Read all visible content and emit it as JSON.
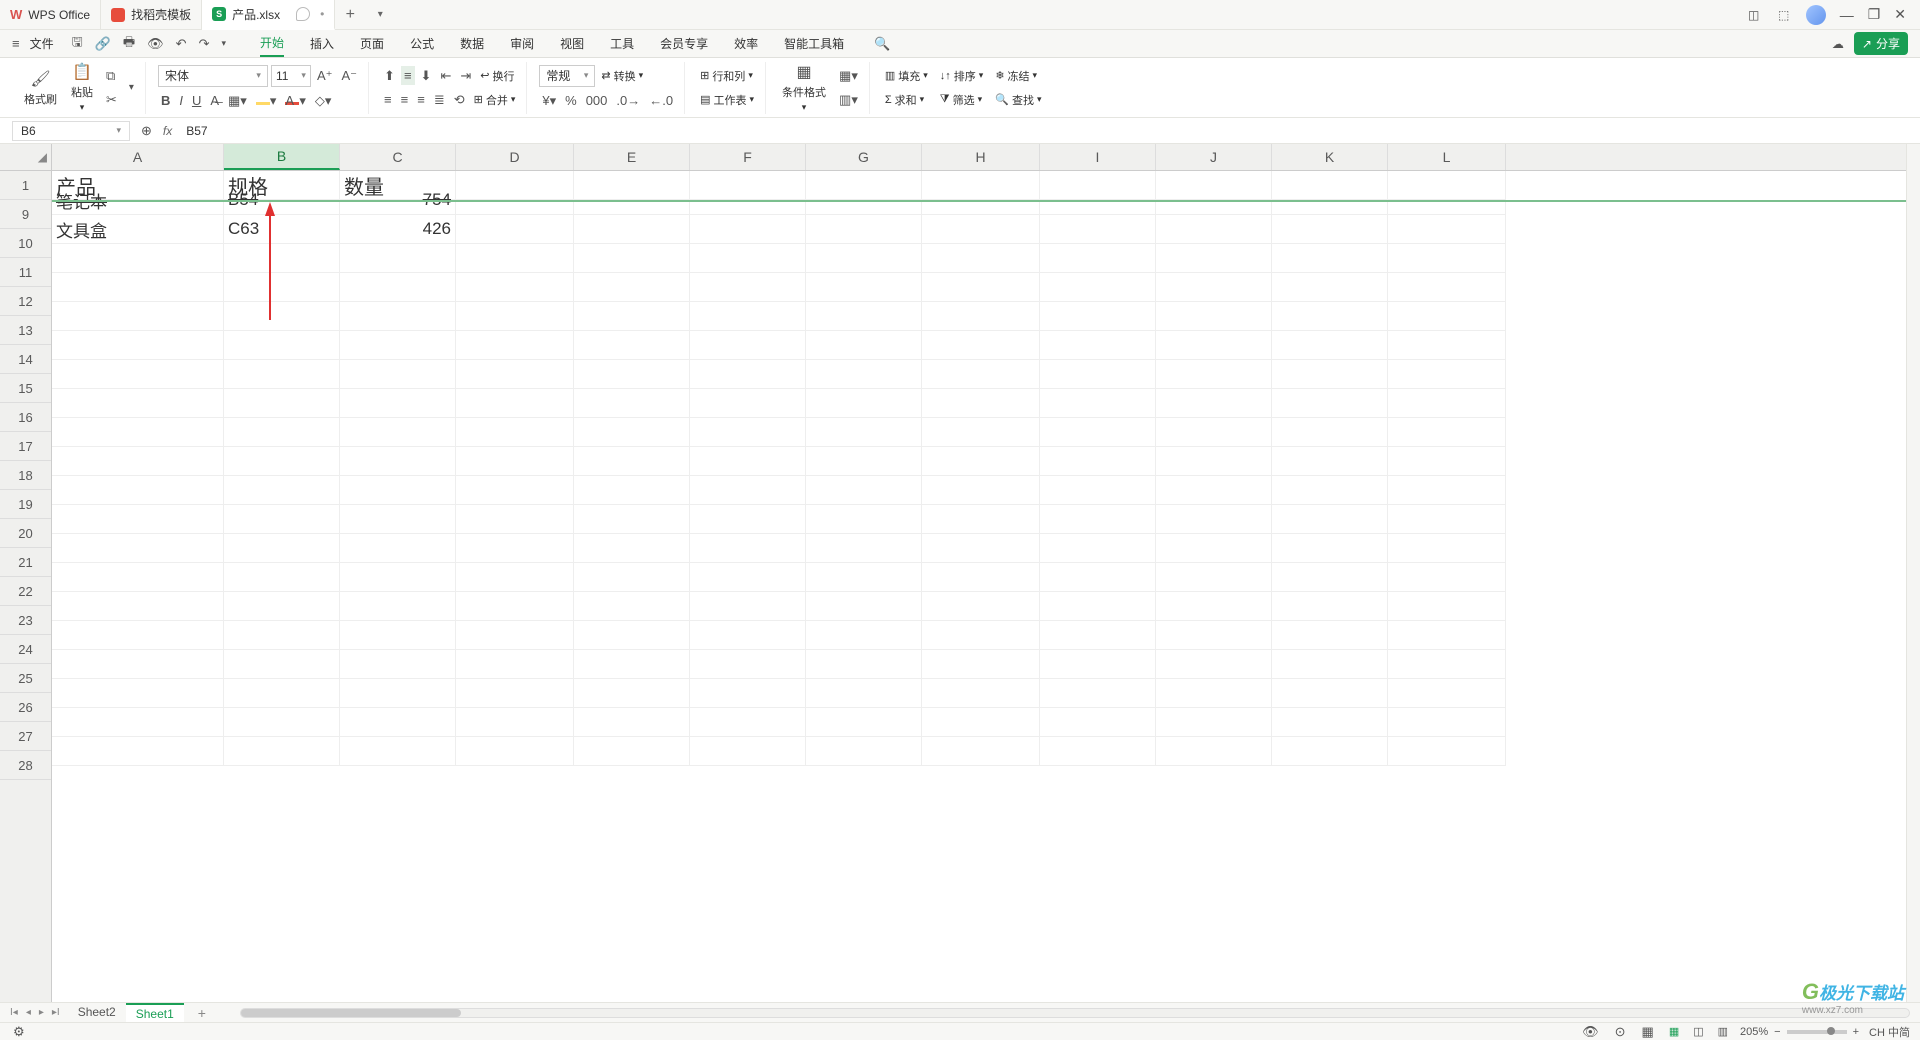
{
  "titlebar": {
    "app": "WPS Office",
    "template_tab": "找稻壳模板",
    "file_tab": "产品.xlsx",
    "file_badge": "S",
    "add": "+"
  },
  "menubar": {
    "file": "文件",
    "menus": [
      "开始",
      "插入",
      "页面",
      "公式",
      "数据",
      "审阅",
      "视图",
      "工具",
      "会员专享",
      "效率",
      "智能工具箱"
    ],
    "active_index": 0,
    "share": "分享"
  },
  "ribbon": {
    "format_painter": "格式刷",
    "paste": "粘贴",
    "font_name": "宋体",
    "font_size": "11",
    "wrap": "换行",
    "merge": "合并",
    "num_format": "常规",
    "convert": "转换",
    "row_col": "行和列",
    "worksheet": "工作表",
    "cond_fmt": "条件格式",
    "sum": "求和",
    "fill": "填充",
    "sort": "排序",
    "filter": "筛选",
    "freeze": "冻结",
    "find": "查找"
  },
  "fxbar": {
    "name": "B6",
    "formula": "B57"
  },
  "columns": [
    "A",
    "B",
    "C",
    "D",
    "E",
    "F",
    "G",
    "H",
    "I",
    "J",
    "K",
    "L"
  ],
  "col_widths": [
    "cw-A",
    "cw-B",
    "cw-C",
    "cw-D",
    "cw-E",
    "cw-F",
    "cw-G",
    "cw-H",
    "cw-I",
    "cw-J",
    "cw-K",
    "cw-L"
  ],
  "selected_col_index": 1,
  "frozen_row": {
    "num": "1",
    "cells": [
      "产品",
      "规格",
      "数量",
      "",
      "",
      "",
      "",
      "",
      "",
      "",
      "",
      ""
    ]
  },
  "rows": [
    {
      "num": "9",
      "cells": [
        "笔记本",
        "B54",
        "754",
        "",
        "",
        "",
        "",
        "",
        "",
        "",
        "",
        ""
      ]
    },
    {
      "num": "10",
      "cells": [
        "文具盒",
        "C63",
        "426",
        "",
        "",
        "",
        "",
        "",
        "",
        "",
        "",
        ""
      ]
    },
    {
      "num": "11",
      "cells": [
        "",
        "",
        "",
        "",
        "",
        "",
        "",
        "",
        "",
        "",
        "",
        ""
      ]
    },
    {
      "num": "12",
      "cells": [
        "",
        "",
        "",
        "",
        "",
        "",
        "",
        "",
        "",
        "",
        "",
        ""
      ]
    },
    {
      "num": "13",
      "cells": [
        "",
        "",
        "",
        "",
        "",
        "",
        "",
        "",
        "",
        "",
        "",
        ""
      ]
    },
    {
      "num": "14",
      "cells": [
        "",
        "",
        "",
        "",
        "",
        "",
        "",
        "",
        "",
        "",
        "",
        ""
      ]
    },
    {
      "num": "15",
      "cells": [
        "",
        "",
        "",
        "",
        "",
        "",
        "",
        "",
        "",
        "",
        "",
        ""
      ]
    },
    {
      "num": "16",
      "cells": [
        "",
        "",
        "",
        "",
        "",
        "",
        "",
        "",
        "",
        "",
        "",
        ""
      ]
    },
    {
      "num": "17",
      "cells": [
        "",
        "",
        "",
        "",
        "",
        "",
        "",
        "",
        "",
        "",
        "",
        ""
      ]
    },
    {
      "num": "18",
      "cells": [
        "",
        "",
        "",
        "",
        "",
        "",
        "",
        "",
        "",
        "",
        "",
        ""
      ]
    },
    {
      "num": "19",
      "cells": [
        "",
        "",
        "",
        "",
        "",
        "",
        "",
        "",
        "",
        "",
        "",
        ""
      ]
    },
    {
      "num": "20",
      "cells": [
        "",
        "",
        "",
        "",
        "",
        "",
        "",
        "",
        "",
        "",
        "",
        ""
      ]
    },
    {
      "num": "21",
      "cells": [
        "",
        "",
        "",
        "",
        "",
        "",
        "",
        "",
        "",
        "",
        "",
        ""
      ]
    },
    {
      "num": "22",
      "cells": [
        "",
        "",
        "",
        "",
        "",
        "",
        "",
        "",
        "",
        "",
        "",
        ""
      ]
    },
    {
      "num": "23",
      "cells": [
        "",
        "",
        "",
        "",
        "",
        "",
        "",
        "",
        "",
        "",
        "",
        ""
      ]
    },
    {
      "num": "24",
      "cells": [
        "",
        "",
        "",
        "",
        "",
        "",
        "",
        "",
        "",
        "",
        "",
        ""
      ]
    },
    {
      "num": "25",
      "cells": [
        "",
        "",
        "",
        "",
        "",
        "",
        "",
        "",
        "",
        "",
        "",
        ""
      ]
    },
    {
      "num": "26",
      "cells": [
        "",
        "",
        "",
        "",
        "",
        "",
        "",
        "",
        "",
        "",
        "",
        ""
      ]
    },
    {
      "num": "27",
      "cells": [
        "",
        "",
        "",
        "",
        "",
        "",
        "",
        "",
        "",
        "",
        "",
        ""
      ]
    },
    {
      "num": "28",
      "cells": [
        "",
        "",
        "",
        "",
        "",
        "",
        "",
        "",
        "",
        "",
        "",
        ""
      ]
    }
  ],
  "numeric_cols": [
    2
  ],
  "sheets": {
    "tabs": [
      "Sheet2",
      "Sheet1"
    ],
    "active_index": 1
  },
  "status": {
    "zoom": "205%",
    "ime": "CH 中简"
  },
  "watermark": {
    "brand": "极光下载站",
    "url": "www.xz7.com"
  }
}
